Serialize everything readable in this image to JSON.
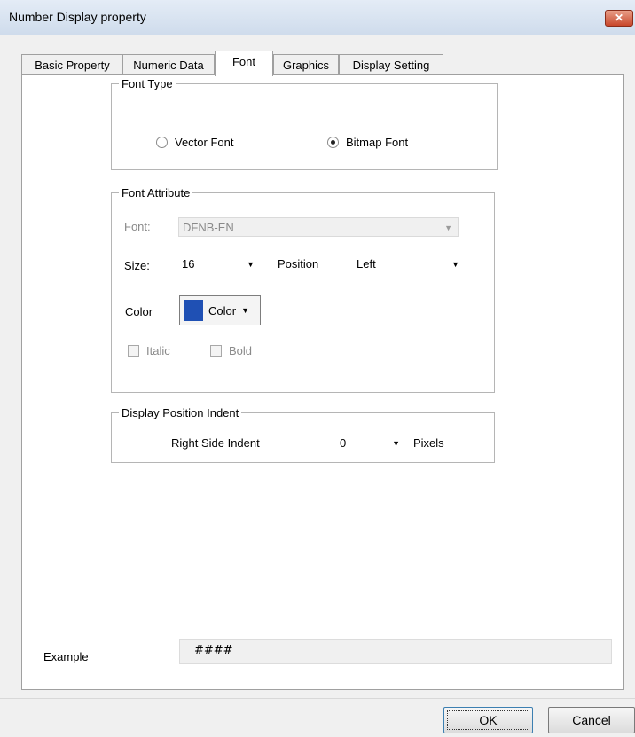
{
  "window": {
    "title": "Number Display property",
    "close_glyph": "✕"
  },
  "tabs": [
    {
      "label": "Basic Property"
    },
    {
      "label": "Numeric Data"
    },
    {
      "label": "Font"
    },
    {
      "label": "Graphics"
    },
    {
      "label": "Display Setting"
    }
  ],
  "active_tab": "Font",
  "font_type": {
    "legend": "Font Type",
    "options": [
      {
        "label": "Vector Font",
        "checked": false
      },
      {
        "label": "Bitmap Font",
        "checked": true
      }
    ]
  },
  "font_attribute": {
    "legend": "Font Attribute",
    "font_label": "Font:",
    "font_value": "DFNB-EN",
    "size_label": "Size:",
    "size_value": "16",
    "position_label": "Position",
    "position_value": "Left",
    "color_label": "Color",
    "color_button_label": "Color",
    "color_swatch": "#1f50b4",
    "italic_label": "Italic",
    "bold_label": "Bold"
  },
  "indent": {
    "legend": "Display Position Indent",
    "right_label": "Right Side Indent",
    "right_value": "0",
    "unit": "Pixels"
  },
  "example": {
    "label": "Example",
    "value": "####"
  },
  "buttons": {
    "ok": "OK",
    "cancel": "Cancel"
  }
}
